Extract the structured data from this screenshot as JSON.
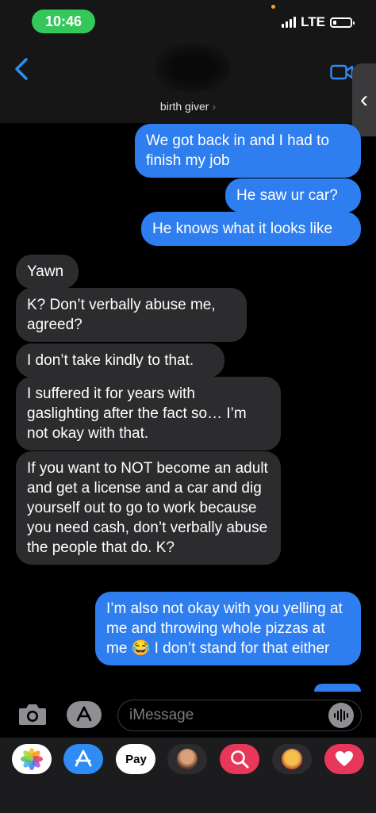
{
  "status": {
    "time": "10:46",
    "network": "LTE"
  },
  "header": {
    "contact_name": "birth giver",
    "chevron": "›"
  },
  "side_handle": "‹",
  "messages": [
    {
      "from": "me",
      "text": "We got back in and I had to finish my job"
    },
    {
      "from": "me",
      "text": "He saw ur car?"
    },
    {
      "from": "me",
      "text": "He knows what it looks like"
    },
    {
      "from": "them",
      "text": "Yawn"
    },
    {
      "from": "them",
      "text": "K? Don’t verbally abuse me, agreed?"
    },
    {
      "from": "them",
      "text": "I don’t take kindly to that."
    },
    {
      "from": "them",
      "text": "I suffered it for years with gaslighting after the fact so… I’m not okay with that."
    },
    {
      "from": "them",
      "text": "If you want to NOT become an adult and get a license and a car and dig yourself out to go to work because you need cash, don’t verbally abuse the people that do. K?"
    },
    {
      "from": "me",
      "text": "I’m also not okay with you yelling at me and throwing whole pizzas at me 😂 I don’t stand for that either"
    }
  ],
  "input": {
    "placeholder": "iMessage"
  },
  "apps": [
    {
      "name": "photos-app-icon"
    },
    {
      "name": "app-store-icon",
      "glyph": "A"
    },
    {
      "name": "apple-pay-icon",
      "label": "Pay"
    },
    {
      "name": "memoji-icon"
    },
    {
      "name": "image-search-icon"
    },
    {
      "name": "memoji-stickers-icon"
    },
    {
      "name": "digital-touch-icon"
    }
  ],
  "colors": {
    "sent_bubble": "#2f7ef0",
    "received_bubble": "#2c2c2e",
    "accent": "#2f8cf5",
    "status_pill": "#35c759"
  }
}
